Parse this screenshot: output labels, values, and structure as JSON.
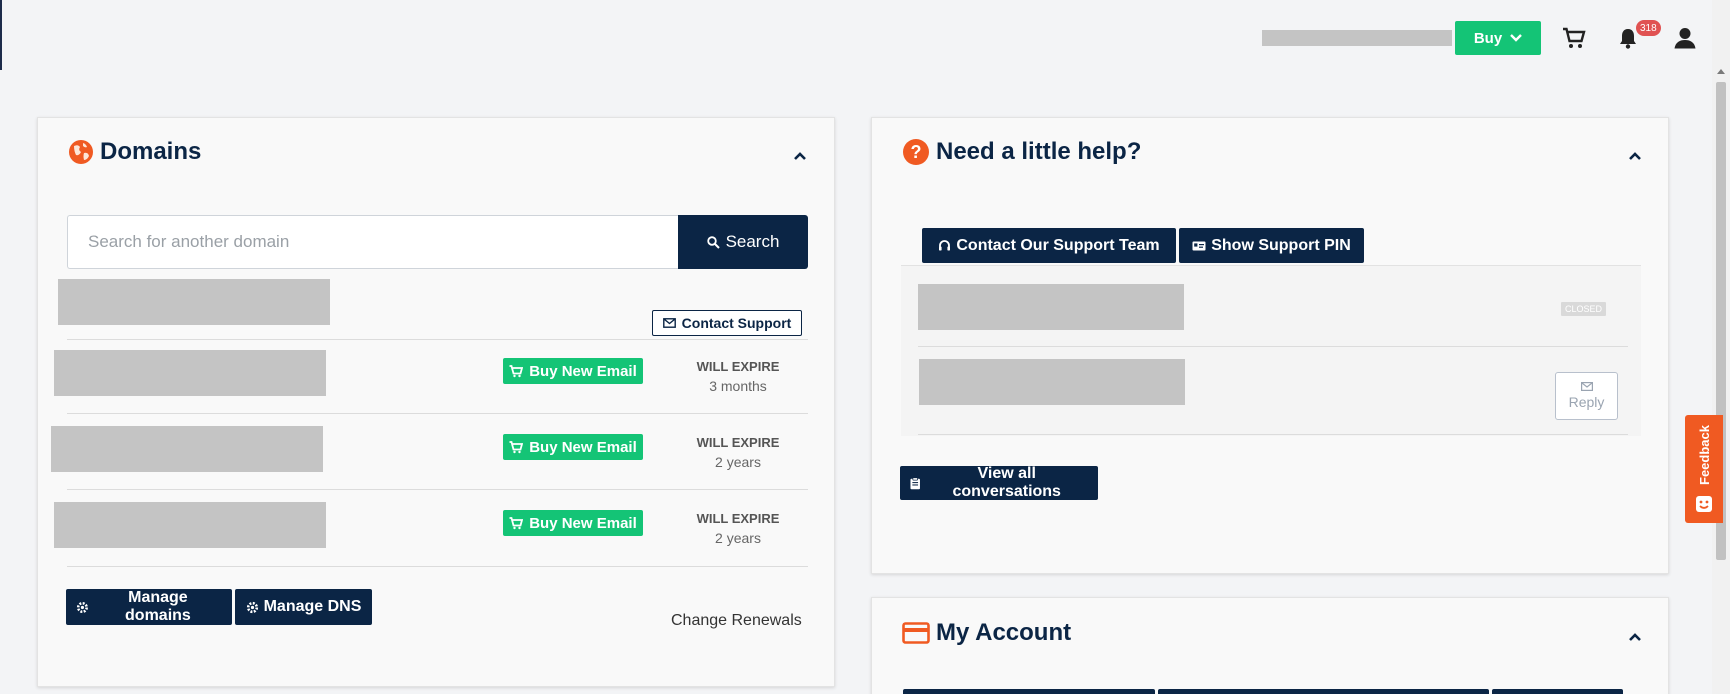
{
  "header": {
    "buy_label": "Buy",
    "notifications_count": "318",
    "icons": [
      "shopping-cart-icon",
      "bell-icon",
      "user-icon"
    ]
  },
  "feedback": {
    "label": "Feedback"
  },
  "domains": {
    "title": "Domains",
    "search_placeholder": "Search for another domain",
    "search_label": "Search",
    "contact_support_label": "Contact Support",
    "rows": [
      {
        "button_label": "Buy New Email",
        "expire_label": "WILL EXPIRE",
        "expire_value": "3 months"
      },
      {
        "button_label": "Buy New Email",
        "expire_label": "WILL EXPIRE",
        "expire_value": "2 years"
      },
      {
        "button_label": "Buy New Email",
        "expire_label": "WILL EXPIRE",
        "expire_value": "2 years"
      }
    ],
    "manage_domains_label": "Manage domains",
    "manage_dns_label": "Manage DNS",
    "change_renewals_label": "Change Renewals"
  },
  "help": {
    "title": "Need a little help?",
    "contact_team_label": "Contact Our Support Team",
    "support_pin_label": "Show Support PIN",
    "closed_label": "CLOSED",
    "reply_label": "Reply",
    "view_all_label": "View all conversations"
  },
  "account": {
    "title": "My Account"
  },
  "colors": {
    "navy": "#0b2545",
    "green": "#14c476",
    "orange": "#f05a22",
    "badge_red": "#e05252"
  }
}
